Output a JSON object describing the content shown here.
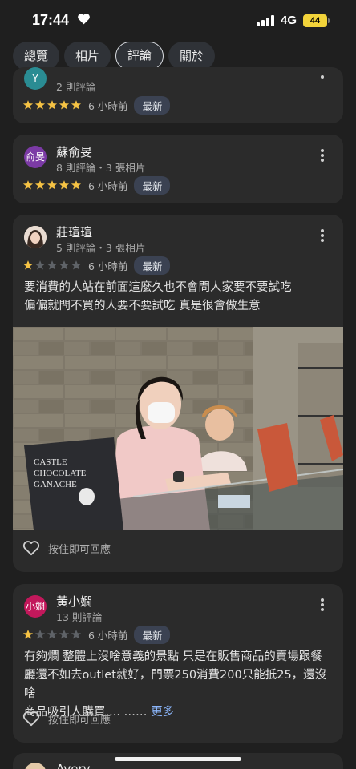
{
  "status": {
    "time": "17:44",
    "network": "4G",
    "battery": "44"
  },
  "tabs": [
    {
      "label": "總覽",
      "active": false
    },
    {
      "label": "相片",
      "active": false
    },
    {
      "label": "評論",
      "active": true
    },
    {
      "label": "關於",
      "active": false
    }
  ],
  "reviews": [
    {
      "avatar_initials": "Y",
      "name": "",
      "meta": "2 則評論",
      "stars": 5,
      "time": "6 小時前",
      "badge": "最新"
    },
    {
      "avatar_initials": "俞旻",
      "avatar_color": "#7b3aa5",
      "name": "蘇俞旻",
      "meta": "8 則評論・3 張相片",
      "stars": 5,
      "time": "6 小時前",
      "badge": "最新"
    },
    {
      "avatar_initials": "",
      "name": "莊瑄瑄",
      "meta": "5 則評論・3 張相片",
      "stars": 1,
      "time": "6 小時前",
      "badge": "最新",
      "text_line1": "要消費的人站在前面這麼久也不會問人家要不要試吃",
      "text_line2": "偏偏就問不買的人要不要試吃 真是很會做生意",
      "photo_sign": [
        "CASTLE",
        "CHOCOLATE",
        "GANACHE"
      ],
      "like_label": "按住即可回應"
    },
    {
      "avatar_initials": "小嫺",
      "avatar_color": "#c2185b",
      "name": "黃小嫺",
      "meta": "13 則評論",
      "stars": 1,
      "time": "6 小時前",
      "badge": "最新",
      "text_line1": "有夠爛 整體上沒啥意義的景點 只是在販售商品的賣場跟餐",
      "text_line2": "廳還不如去outlet就好，門票250消費200只能抵25，還沒啥",
      "text_line3": "商品吸引人購買.... ……",
      "read_more": "更多",
      "like_label": "按住即可回應"
    },
    {
      "name": "Avery"
    }
  ],
  "colors": {
    "star_filled": "#f6c344",
    "star_empty": "#5f6368",
    "link": "#8ab4f8"
  }
}
